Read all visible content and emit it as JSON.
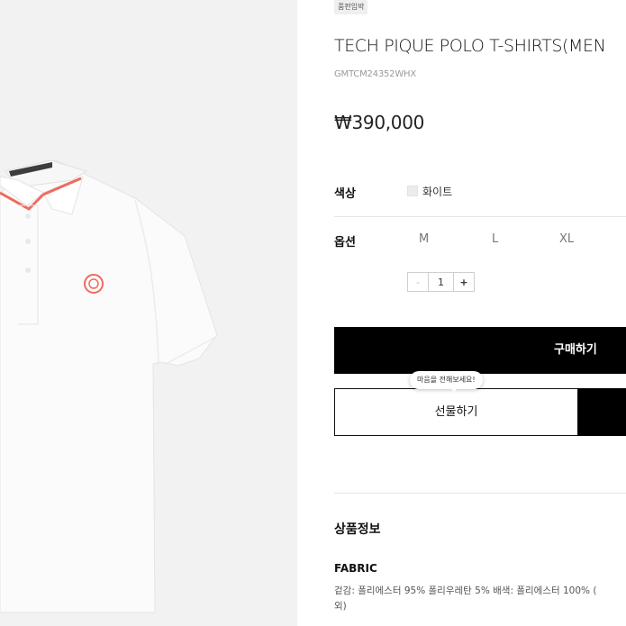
{
  "product": {
    "badge": "품펀임박",
    "title": "TECH PIQUE POLO T-SHIRTS(MEN",
    "code": "GMTCM24352WHX",
    "price": "₩390,000"
  },
  "options": {
    "color_label": "색상",
    "color_value": "화이트",
    "size_label": "옵션",
    "sizes": [
      "M",
      "L",
      "XL"
    ],
    "quantity": "1",
    "minus_symbol": "-",
    "plus_symbol": "+"
  },
  "actions": {
    "buy_label": "구매하기",
    "gift_label": "선물하기",
    "tooltip": "마음을 전해보세요!"
  },
  "details": {
    "section_title": "상품정보",
    "fabric_label": "FABRIC",
    "fabric_line1": "겉감: 폴리에스터 95% 폴리우레탄 5% 배색: 폴리에스터 100% (",
    "fabric_line2": "외)"
  },
  "colors": {
    "image_bg": "#f2f2f2",
    "accent_collar": "#f06a5e",
    "primary_button": "#000000"
  }
}
